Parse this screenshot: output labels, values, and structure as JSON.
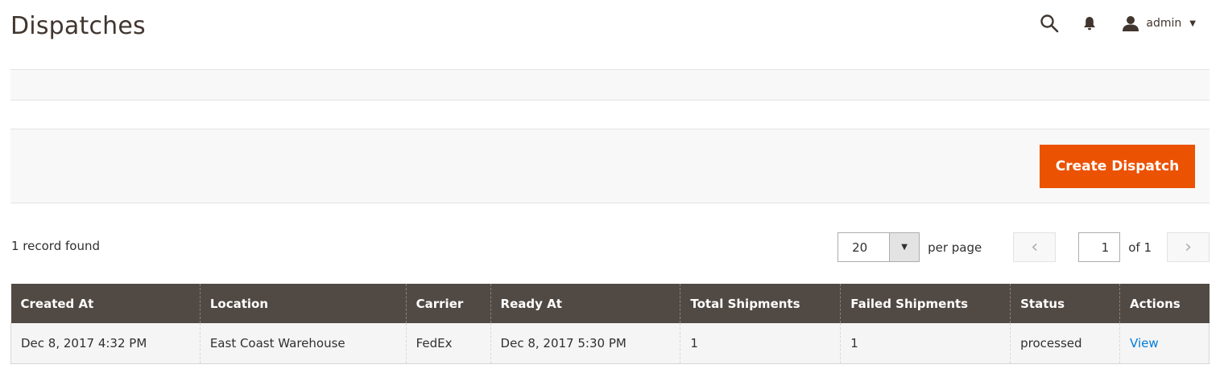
{
  "page": {
    "title": "Dispatches"
  },
  "header": {
    "search_icon": "search-icon",
    "notifications_icon": "bell-icon",
    "user_icon": "user-icon",
    "user_name": "admin"
  },
  "actions": {
    "create_label": "Create Dispatch",
    "accent_color": "#eb5202"
  },
  "grid": {
    "records_found": "1 record found",
    "per_page_value": "20",
    "per_page_label": "per page",
    "current_page": "1",
    "of_pages": "of 1",
    "columns": [
      "Created At",
      "Location",
      "Carrier",
      "Ready At",
      "Total Shipments",
      "Failed Shipments",
      "Status",
      "Actions"
    ],
    "header_color": "#514943",
    "link_color": "#007bdb",
    "rows": [
      {
        "created_at": "Dec 8, 2017 4:32 PM",
        "location": "East Coast Warehouse",
        "carrier": "FedEx",
        "ready_at": "Dec 8, 2017 5:30 PM",
        "total_shipments": "1",
        "failed_shipments": "1",
        "status": "processed",
        "action": "View"
      }
    ]
  }
}
